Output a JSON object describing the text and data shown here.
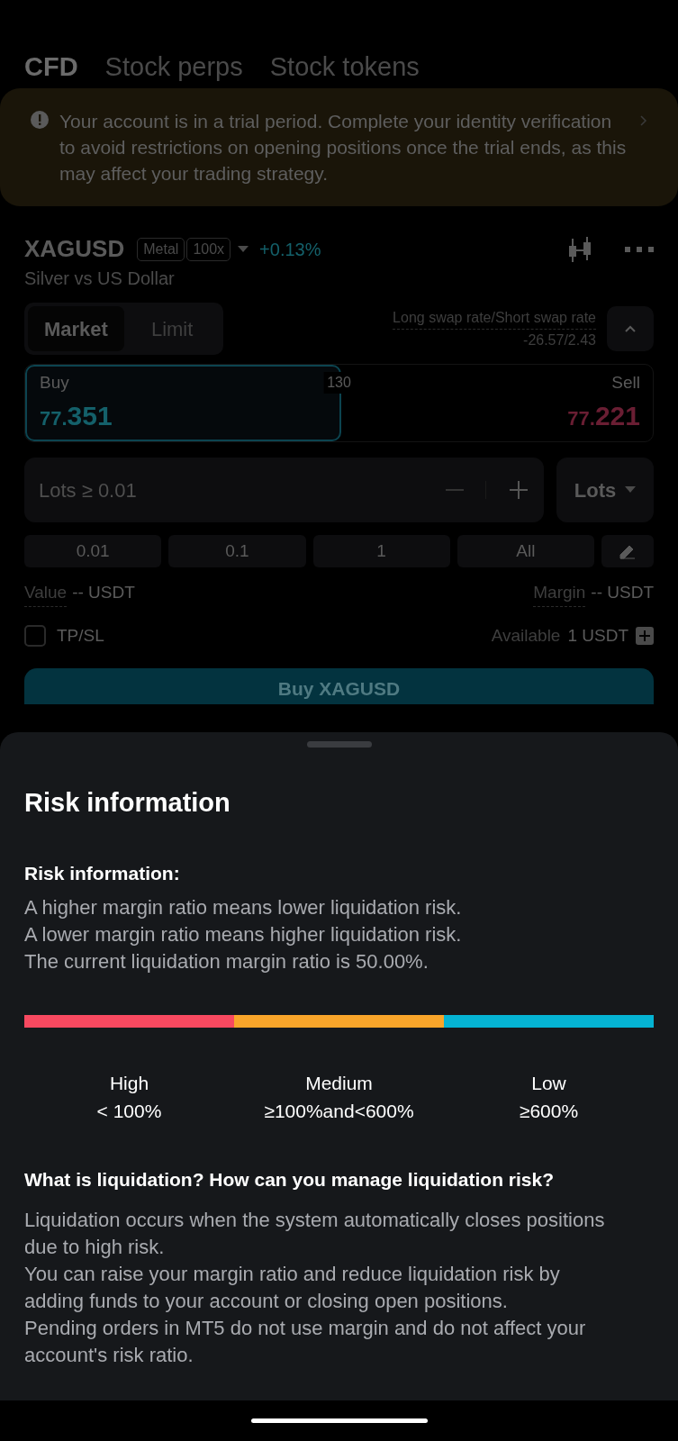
{
  "tabs": [
    {
      "label": "CFD",
      "selected": true
    },
    {
      "label": "Stock perps",
      "selected": false
    },
    {
      "label": "Stock tokens",
      "selected": false
    }
  ],
  "notice": {
    "text": "Your account is in a trial period. Complete your identity verification to avoid restrictions on opening positions once the trial ends, as this may affect your trading strategy."
  },
  "instrument": {
    "symbol": "XAGUSD",
    "tags": [
      "Metal",
      "100x"
    ],
    "change": "+0.13%",
    "name": "Silver vs US Dollar"
  },
  "order_types": [
    {
      "label": "Market",
      "selected": true
    },
    {
      "label": "Limit",
      "selected": false
    }
  ],
  "swap": {
    "label": "Long swap rate/Short swap rate",
    "value": "-26.57/2.43"
  },
  "sides": [
    {
      "label": "Buy",
      "price_small": "77.",
      "price_big": "351",
      "selected": true
    },
    {
      "label": "Sell",
      "price_small": "77.",
      "price_big": "221",
      "selected": false
    }
  ],
  "spread": "130",
  "lots": {
    "placeholder": "Lots ≥ 0.01",
    "unit": "Lots"
  },
  "presets": [
    "0.01",
    "0.1",
    "1",
    "All"
  ],
  "value": {
    "label": "Value",
    "amount": "-- USDT"
  },
  "margin": {
    "label": "Margin",
    "amount": "-- USDT"
  },
  "tpsl": {
    "label": "TP/SL",
    "checked": false
  },
  "available": {
    "label": "Available",
    "amount": "1 USDT"
  },
  "submit": "Buy XAGUSD",
  "sheet": {
    "title": "Risk information",
    "heading": "Risk information:",
    "lines": [
      "A higher margin ratio means lower liquidation risk.",
      "A lower margin ratio means higher liquidation risk.",
      "The current liquidation margin ratio is 50.00%."
    ],
    "levels": [
      {
        "name": "High",
        "range": "< 100%",
        "color": "#f84960"
      },
      {
        "name": "Medium",
        "range": "≥100%and<600%",
        "color": "#f9a52a"
      },
      {
        "name": "Low",
        "range": "≥600%",
        "color": "#05b3d3"
      }
    ],
    "question": "What is liquidation? How can you manage liquidation risk?",
    "answer": [
      "Liquidation occurs when the system automatically closes positions due to high risk.",
      "You can raise your margin ratio and reduce liquidation risk by adding funds to your account or closing open positions.",
      "Pending orders in MT5 do not use margin and do not affect your account's risk ratio."
    ]
  }
}
